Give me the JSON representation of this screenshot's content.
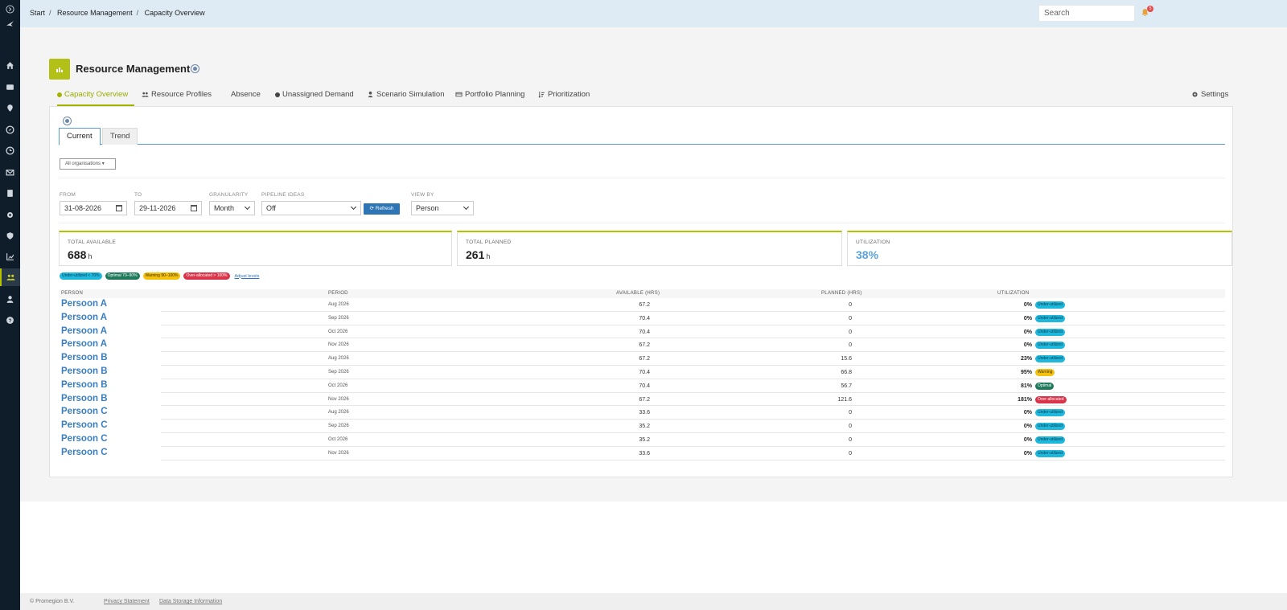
{
  "sidebar": {
    "items": [
      {
        "icon": "chevron-right-icon"
      },
      {
        "icon": "bird-logo-icon"
      },
      {
        "icon": "home-icon"
      },
      {
        "icon": "inbox-icon"
      },
      {
        "icon": "map-pin-icon"
      },
      {
        "icon": "compass-icon"
      },
      {
        "icon": "clock-icon"
      },
      {
        "icon": "mail-icon"
      },
      {
        "icon": "document-icon"
      },
      {
        "icon": "gear-icon"
      },
      {
        "icon": "shield-icon"
      },
      {
        "icon": "chart-icon"
      },
      {
        "icon": "people-icon"
      },
      {
        "icon": "user-icon"
      },
      {
        "icon": "help-icon"
      }
    ],
    "active_color": "#c9d22c"
  },
  "header": {
    "breadcrumb": [
      "Start",
      "Resource Management",
      "Capacity Overview"
    ],
    "search_placeholder": "Search",
    "notification_count": "5"
  },
  "page": {
    "title": "Resource Management",
    "tabs": [
      {
        "label": "Capacity Overview",
        "active": true
      },
      {
        "label": "Resource Profiles"
      },
      {
        "label": "Absence"
      },
      {
        "label": "Unassigned Demand"
      },
      {
        "label": "Scenario Simulation"
      },
      {
        "label": "Portfolio Planning"
      },
      {
        "label": "Prioritization"
      },
      {
        "label": "Settings"
      }
    ]
  },
  "subtabs": [
    "Current",
    "Trend"
  ],
  "filters": {
    "org_select": "All organisations",
    "from_label": "FROM",
    "from_value": "31-08-2026",
    "to_label": "TO",
    "to_value": "29-11-2026",
    "granularity_label": "GRANULARITY",
    "granularity_value": "Month",
    "pipeline_label": "PIPELINE IDEAS",
    "pipeline_value": "Off",
    "refresh_label": "Refresh",
    "viewby_label": "VIEW BY",
    "viewby_value": "Person"
  },
  "stats": {
    "available_label": "TOTAL AVAILABLE",
    "available_value": "688",
    "available_unit": "h",
    "planned_label": "TOTAL PLANNED",
    "planned_value": "261",
    "planned_unit": "h",
    "util_label": "UTILIZATION",
    "util_value": "38%"
  },
  "legend": {
    "under": "Under-utilized < 70%",
    "optimal": "Optimal 70–90%",
    "warning": "Warning 90–100%",
    "over": "Over-allocated > 100%",
    "adjust": "Adjust levels"
  },
  "table": {
    "headers": [
      "PERSON",
      "PERIOD",
      "AVAILABLE (HRS)",
      "PLANNED (HRS)",
      "UTILIZATION"
    ],
    "rows": [
      {
        "person": "Persoon A",
        "period": "Aug 2026",
        "available": "67.2",
        "planned": "0",
        "util": "0%",
        "status": "Under-utilized",
        "kind": "under"
      },
      {
        "person": "Persoon A",
        "period": "Sep 2026",
        "available": "70.4",
        "planned": "0",
        "util": "0%",
        "status": "Under-utilized",
        "kind": "under"
      },
      {
        "person": "Persoon A",
        "period": "Oct 2026",
        "available": "70.4",
        "planned": "0",
        "util": "0%",
        "status": "Under-utilized",
        "kind": "under"
      },
      {
        "person": "Persoon A",
        "period": "Nov 2026",
        "available": "67.2",
        "planned": "0",
        "util": "0%",
        "status": "Under-utilized",
        "kind": "under"
      },
      {
        "person": "Persoon B",
        "period": "Aug 2026",
        "available": "67.2",
        "planned": "15.6",
        "util": "23%",
        "status": "Under-utilized",
        "kind": "under"
      },
      {
        "person": "Persoon B",
        "period": "Sep 2026",
        "available": "70.4",
        "planned": "66.8",
        "util": "95%",
        "status": "Warning",
        "kind": "warning"
      },
      {
        "person": "Persoon B",
        "period": "Oct 2026",
        "available": "70.4",
        "planned": "56.7",
        "util": "81%",
        "status": "Optimal",
        "kind": "optimal"
      },
      {
        "person": "Persoon B",
        "period": "Nov 2026",
        "available": "67.2",
        "planned": "121.6",
        "util": "181%",
        "status": "Over-allocated",
        "kind": "over"
      },
      {
        "person": "Persoon C",
        "period": "Aug 2026",
        "available": "33.6",
        "planned": "0",
        "util": "0%",
        "status": "Under-utilized",
        "kind": "under"
      },
      {
        "person": "Persoon C",
        "period": "Sep 2026",
        "available": "35.2",
        "planned": "0",
        "util": "0%",
        "status": "Under-utilized",
        "kind": "under"
      },
      {
        "person": "Persoon C",
        "period": "Oct 2026",
        "available": "35.2",
        "planned": "0",
        "util": "0%",
        "status": "Under-utilized",
        "kind": "under"
      },
      {
        "person": "Persoon C",
        "period": "Nov 2026",
        "available": "33.6",
        "planned": "0",
        "util": "0%",
        "status": "Under-utilized",
        "kind": "under"
      }
    ]
  },
  "footer": {
    "copyright": "© Promegion B.V.",
    "privacy": "Privacy Statement",
    "storage": "Data Storage Information"
  },
  "colors": {
    "accent": "#b5c200",
    "link": "#3a7ec2",
    "sidebar_bg": "#0f1d2b",
    "header_bg": "#deebf5"
  }
}
